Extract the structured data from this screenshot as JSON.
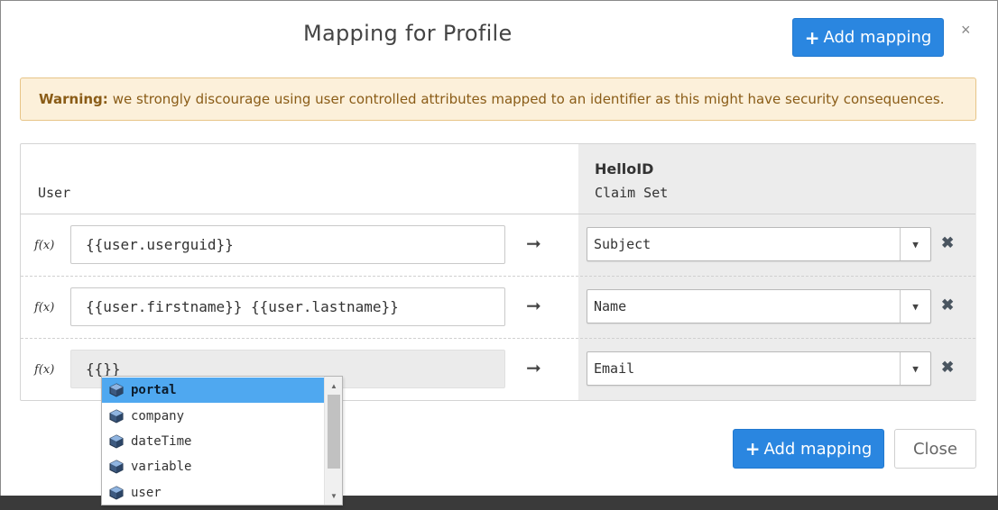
{
  "dialog": {
    "title": "Mapping for Profile",
    "add_mapping_label": "Add mapping",
    "close_label": "Close",
    "close_x": "×"
  },
  "warning": {
    "strong": "Warning:",
    "text": "we strongly discourage using user controlled attributes mapped to an identifier as this might have security consequences."
  },
  "table": {
    "left_header": "User",
    "right_header_title": "HelloID",
    "right_header_sub": "Claim Set",
    "rows": [
      {
        "fx": "f(x)",
        "expression": "{{user.userguid}}",
        "arrow": "➞",
        "claim": "Subject"
      },
      {
        "fx": "f(x)",
        "expression": "{{user.firstname}} {{user.lastname}}",
        "arrow": "➞",
        "claim": "Name"
      },
      {
        "fx": "f(x)",
        "expression": "{{}}",
        "arrow": "➞",
        "claim": "Email"
      }
    ]
  },
  "autocomplete": {
    "items": [
      "portal",
      "company",
      "dateTime",
      "variable",
      "user"
    ],
    "selected_index": 0
  },
  "icons": {
    "plus": "+",
    "caret": "▼",
    "remove": "✖",
    "scroll_up": "▲",
    "scroll_down": "▼"
  },
  "colors": {
    "primary": "#2a86e0",
    "warning_bg": "#fcf0da",
    "warning_text": "#8a5c17",
    "autocomplete_selected": "#4fa8f0"
  }
}
